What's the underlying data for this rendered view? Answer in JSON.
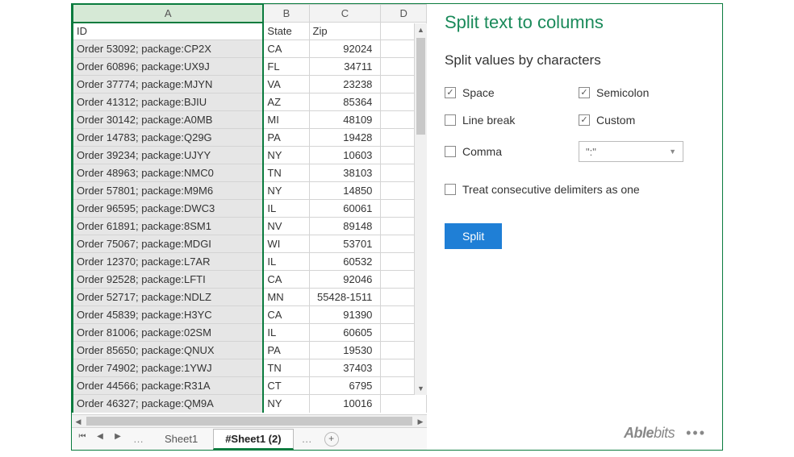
{
  "grid": {
    "columns": [
      "A",
      "B",
      "C",
      "D"
    ],
    "headers": {
      "id": "ID",
      "state": "State",
      "zip": "Zip"
    },
    "rows": [
      {
        "id": "Order 53092; package:CP2X",
        "state": "CA",
        "zip": "92024"
      },
      {
        "id": "Order 60896; package:UX9J",
        "state": "FL",
        "zip": "34711"
      },
      {
        "id": "Order 37774; package:MJYN",
        "state": "VA",
        "zip": "23238"
      },
      {
        "id": "Order 41312; package:BJIU",
        "state": "AZ",
        "zip": "85364"
      },
      {
        "id": "Order 30142; package:A0MB",
        "state": "MI",
        "zip": "48109"
      },
      {
        "id": "Order 14783; package:Q29G",
        "state": "PA",
        "zip": "19428"
      },
      {
        "id": "Order 39234; package:UJYY",
        "state": "NY",
        "zip": "10603"
      },
      {
        "id": "Order 48963; package:NMC0",
        "state": "TN",
        "zip": "38103"
      },
      {
        "id": "Order 57801; package:M9M6",
        "state": "NY",
        "zip": "14850"
      },
      {
        "id": "Order 96595; package:DWC3",
        "state": "IL",
        "zip": "60061"
      },
      {
        "id": "Order 61891; package:8SM1",
        "state": "NV",
        "zip": "89148"
      },
      {
        "id": "Order 75067; package:MDGI",
        "state": "WI",
        "zip": "53701"
      },
      {
        "id": "Order 12370; package:L7AR",
        "state": "IL",
        "zip": "60532"
      },
      {
        "id": "Order 92528; package:LFTI",
        "state": "CA",
        "zip": "92046"
      },
      {
        "id": "Order 52717; package:NDLZ",
        "state": "MN",
        "zip": "55428-1511"
      },
      {
        "id": "Order 45839; package:H3YC",
        "state": "CA",
        "zip": "91390"
      },
      {
        "id": "Order 81006; package:02SM",
        "state": "IL",
        "zip": "60605"
      },
      {
        "id": "Order 85650; package:QNUX",
        "state": "PA",
        "zip": "19530"
      },
      {
        "id": "Order 74902; package:1YWJ",
        "state": "TN",
        "zip": "37403"
      },
      {
        "id": "Order 44566; package:R31A",
        "state": "CT",
        "zip": "6795"
      },
      {
        "id": "Order 46327; package:QM9A",
        "state": "NY",
        "zip": "10016"
      }
    ]
  },
  "tabs": [
    {
      "label": "Sheet1",
      "active": false
    },
    {
      "label": "#Sheet1 (2)",
      "active": true
    }
  ],
  "panel": {
    "title": "Split text to columns",
    "subtitle": "Split values by characters",
    "options": {
      "space": "Space",
      "semicolon": "Semicolon",
      "linebreak": "Line break",
      "custom": "Custom",
      "comma": "Comma"
    },
    "custom_value": "\":\"",
    "treat_consecutive": "Treat consecutive delimiters as one",
    "split_button": "Split"
  },
  "brand": {
    "part1": "Able",
    "part2": "bits"
  }
}
